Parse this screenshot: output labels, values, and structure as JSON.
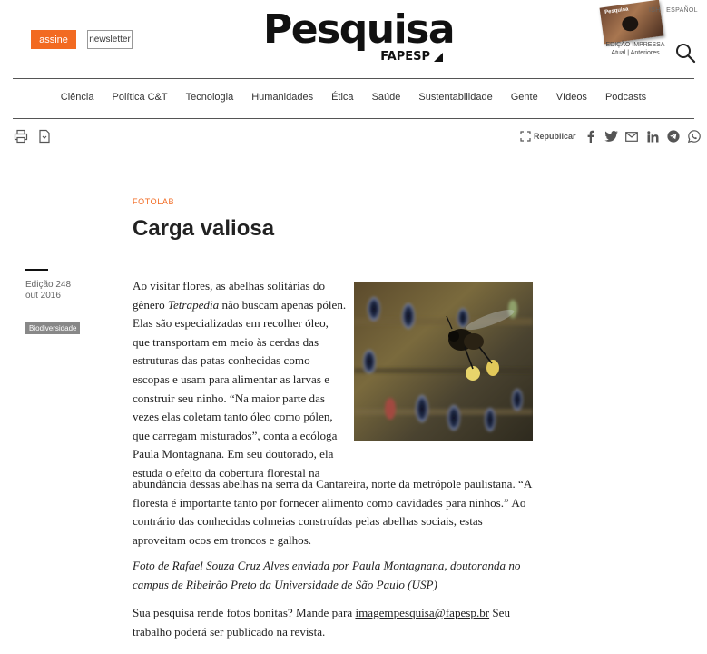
{
  "header": {
    "assine_label": "assine",
    "newsletter_label": "newsletter",
    "logo_main": "Pesquisa",
    "logo_sub": "FAPESP",
    "lang_label": "ISH | ESPAÑOL",
    "edicao_impressa": "EDIÇÃO IMPRESSA",
    "edicao_links": "Atual | Anteriores",
    "mag_cover_title": "Pesquisa"
  },
  "nav": {
    "items": [
      "Ciência",
      "Política C&T",
      "Tecnologia",
      "Humanidades",
      "Ética",
      "Saúde",
      "Sustentabilidade",
      "Gente",
      "Vídeos",
      "Podcasts"
    ]
  },
  "tools": {
    "republicar_label": "Republicar"
  },
  "article": {
    "section": "FOTOLAB",
    "title": "Carga valiosa",
    "edition": "Edição 248",
    "date": "out 2016",
    "tag": "Biodiversidade",
    "lead_1": "Ao visitar flores, as abelhas solitárias do gênero ",
    "lead_genus": "Tetrapedia",
    "lead_2": " não buscam apenas pólen. Elas são especializadas em recolher óleo, que transportam em meio às cerdas das estruturas das patas conhecidas como escopas e usam para alimentar as larvas e construir seu ninho. “Na maior parte das vezes elas coletam tanto óleo como pólen, que carregam misturados”, conta a ecóloga Paula Montagnana. Em seu doutorado, ela estuda o efeito da cobertura florestal na",
    "lead_cont": "abundância dessas abelhas na serra da Cantareira, norte da metrópole paulistana. “A floresta é importante tanto por fornecer alimento como cavidades para ninhos.” Ao contrário das conhecidas colmeias construídas pelas abelhas sociais, estas aproveitam ocos em troncos e galhos.",
    "credit": "Foto de Rafael Souza Cruz Alves enviada por Paula Montagnana, doutoranda no campus de Ribeirão Preto da Universidade de São Paulo (USP)",
    "cta_1": "Sua pesquisa rende fotos bonitas? Mande para ",
    "cta_email": "imagempesquisa@fapesp.br",
    "cta_2": " Seu trabalho poderá ser publicado na revista."
  },
  "colors": {
    "accent": "#f26a21",
    "tag_bg": "#888888"
  }
}
